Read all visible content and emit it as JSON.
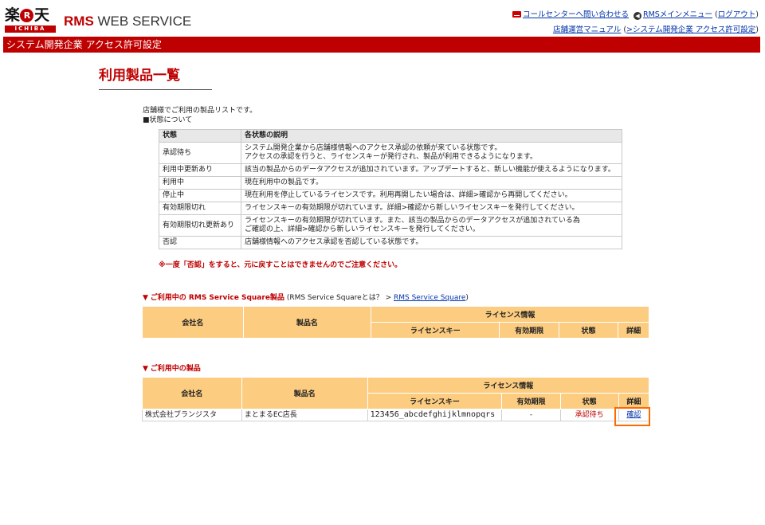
{
  "header": {
    "logo_kanji_1": "楽",
    "logo_r": "R",
    "logo_kanji_2": "天",
    "logo_sub": "ICHIBA",
    "brand_bold": "RMS",
    "brand_rest": " WEB SERVICE",
    "call_center": "コールセンターへ問い合わせる",
    "rms_menu": "RMSメインメニュー",
    "logout": "ログアウト",
    "manual": "店舗運営マニュアル",
    "access_link": ">システム開発企業 アクセス許可設定"
  },
  "redbar_title": "システム開発企業 アクセス許可設定",
  "page_title": "利用製品一覧",
  "intro": {
    "line1": "店舗様でご利用の製品リストです。",
    "line2": "■状態について"
  },
  "status_table": {
    "headers": [
      "状態",
      "各状態の説明"
    ],
    "rows": [
      {
        "state": "承認待ち",
        "desc1": "システム開発企業から店舗様情報へのアクセス承認の依頼が来ている状態です。",
        "desc2": "アクセスの承認を行うと、ライセンスキーが発行され、製品が利用できるようになります。"
      },
      {
        "state": "利用中更新あり",
        "desc1": "該当の製品からのデータアクセスが追加されています。アップデートすると、新しい機能が使えるようになります。",
        "desc2": ""
      },
      {
        "state": "利用中",
        "desc1": "現在利用中の製品です。",
        "desc2": ""
      },
      {
        "state": "停止中",
        "desc1": "現在利用を停止しているライセンスです。利用再開したい場合は、詳細>確認から再開してください。",
        "desc2": ""
      },
      {
        "state": "有効期限切れ",
        "desc1": "ライセンスキーの有効期限が切れています。詳細>確認から新しいライセンスキーを発行してください。",
        "desc2": ""
      },
      {
        "state": "有効期限切れ更新あり",
        "desc1": "ライセンスキーの有効期限が切れています。また、該当の製品からのデータアクセスが追加されている為",
        "desc2": "ご確認の上、詳細>確認から新しいライセンスキーを発行してください。"
      },
      {
        "state": "否認",
        "desc1": "店舗様情報へのアクセス承認を否認している状態です。",
        "desc2": ""
      }
    ]
  },
  "warning": "※一度「否認」をすると、元に戻すことはできませんのでご注意ください。",
  "section_rss": {
    "tri": "▼",
    "label": "ご利用中の RMS Service Square製品",
    "paren_open": "(RMS Service Squareとは？ > ",
    "link": "RMS Service Square",
    "paren_close": ")"
  },
  "section_products": {
    "tri": "▼",
    "label": "ご利用中の製品"
  },
  "columns": {
    "company": "会社名",
    "product": "製品名",
    "license_info": "ライセンス情報",
    "license_key": "ライセンスキー",
    "expiry": "有効期限",
    "state": "状態",
    "detail": "詳細"
  },
  "products": [
    {
      "company": "株式会社ブランジスタ",
      "product": "まとまるEC店長",
      "license_key": "123456_abcdefghijklmnopqrs",
      "expiry": "-",
      "state": "承認待ち",
      "detail_link": "確認"
    }
  ]
}
